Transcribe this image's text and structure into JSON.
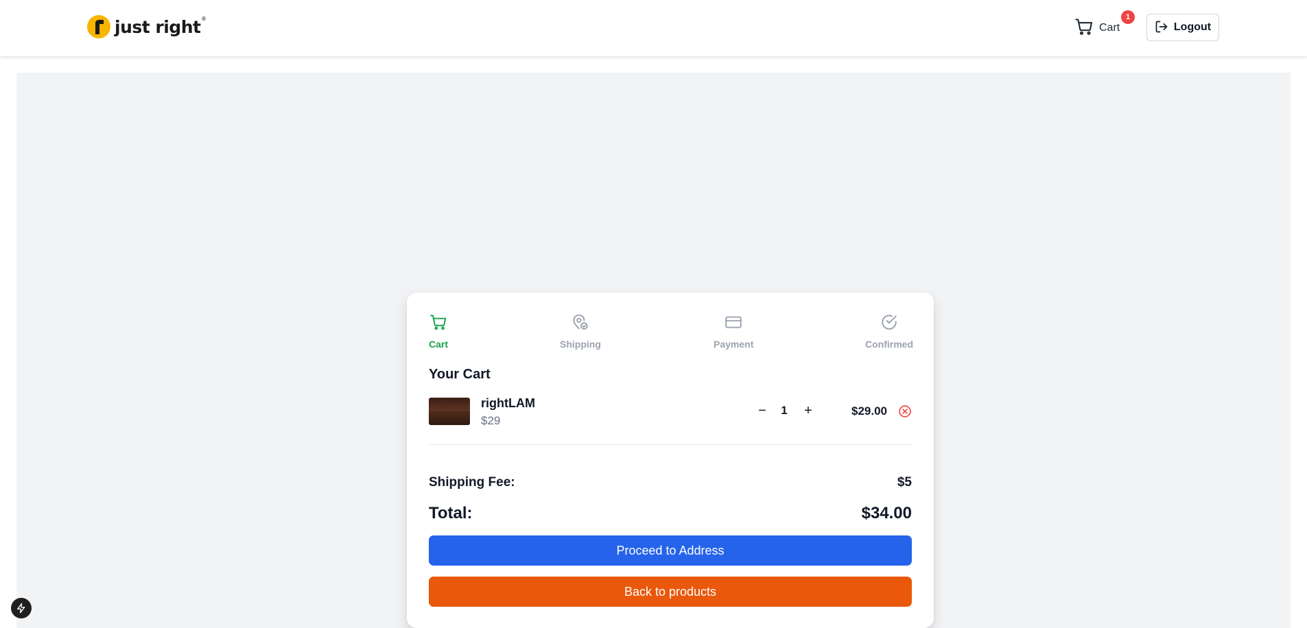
{
  "brand": {
    "name": "just right",
    "reg_mark": "®",
    "accent": "#f7b500"
  },
  "header": {
    "cart_label": "Cart",
    "cart_count": "1",
    "logout_label": "Logout"
  },
  "steps": [
    {
      "label": "Cart",
      "icon": "cart-icon",
      "active": true
    },
    {
      "label": "Shipping",
      "icon": "map-pin-icon",
      "active": false
    },
    {
      "label": "Payment",
      "icon": "credit-card-icon",
      "active": false
    },
    {
      "label": "Confirmed",
      "icon": "check-circle-icon",
      "active": false
    }
  ],
  "cart": {
    "title": "Your Cart",
    "items": [
      {
        "name": "rightLAM",
        "unit_price": "$29",
        "quantity": "1",
        "line_total": "$29.00"
      }
    ],
    "qty_decrement": "−",
    "qty_increment": "+",
    "shipping_label": "Shipping Fee:",
    "shipping_value": "$5",
    "total_label": "Total:",
    "total_value": "$34.00",
    "proceed_label": "Proceed to Address",
    "back_label": "Back to products"
  },
  "colors": {
    "active_step": "#16a34a",
    "inactive_step": "#9ca3af",
    "primary_button": "#2563eb",
    "secondary_button": "#ea580c",
    "badge": "#ef4444",
    "remove": "#ef4444"
  }
}
